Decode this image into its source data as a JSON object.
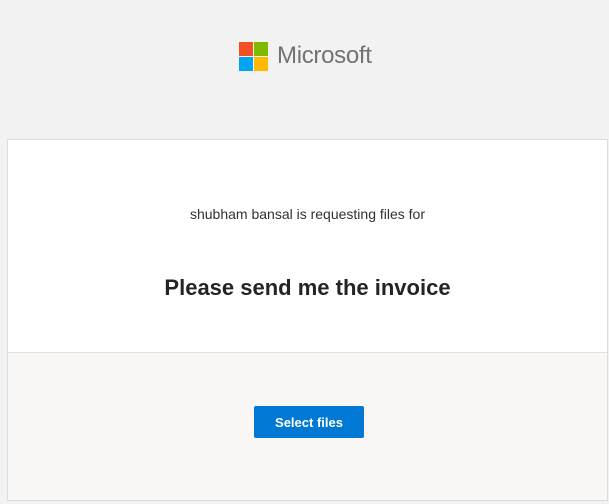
{
  "brand": {
    "name": "Microsoft",
    "logo_icon": "microsoft-logo-icon",
    "logo_colors": [
      "#f25022",
      "#7fba00",
      "#00a4ef",
      "#ffb900"
    ]
  },
  "request": {
    "requester_text": "shubham bansal is requesting files for",
    "title": "Please send me the invoice"
  },
  "actions": {
    "select_files_label": "Select files"
  },
  "colors": {
    "accent": "#0078d4",
    "page_background": "#f2f2f2",
    "action_area_background": "#f8f7f6"
  }
}
